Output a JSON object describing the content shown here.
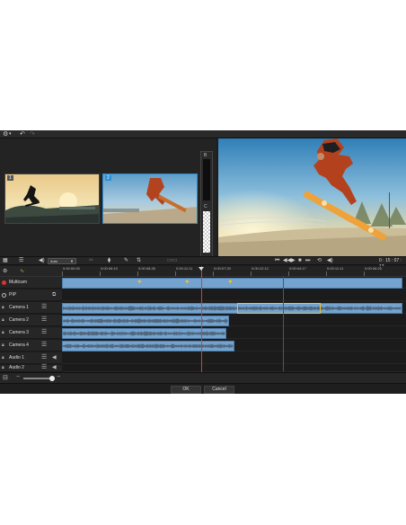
{
  "toolbar": {
    "settings_icon": "gear-icon",
    "undo_icon": "undo-icon",
    "redo_icon": "redo-icon"
  },
  "source_panel": {
    "cameras": [
      {
        "label": "1",
        "selected": false
      },
      {
        "label": "2",
        "selected": true
      }
    ],
    "meter_labels": {
      "top": "B",
      "bottom": "C"
    }
  },
  "transport": {
    "zoom_value": "Auto",
    "timecode": "0 : 15 : 07 : 17"
  },
  "timeline": {
    "ruler_ticks": [
      "0:00:00:00",
      "0:00:06:19",
      "0:00:08:26",
      "0:00:11:11",
      "0:00:07:20",
      "0:00:12:12",
      "0:00:04:17",
      "0:00:11:11",
      "0:00:06:25"
    ],
    "tracks": [
      {
        "name": "Multicam",
        "type": "multicam"
      },
      {
        "name": "PIP",
        "type": "pip"
      },
      {
        "name": "Camera 1",
        "type": "camera"
      },
      {
        "name": "Camera 2",
        "type": "camera"
      },
      {
        "name": "Camera 3",
        "type": "camera"
      },
      {
        "name": "Camera 4",
        "type": "camera"
      },
      {
        "name": "Audio 1",
        "type": "audio"
      },
      {
        "name": "Audio 2",
        "type": "audio"
      }
    ]
  },
  "footer": {
    "ok_label": "OK",
    "cancel_label": "Cancel"
  },
  "colors": {
    "clip": "#73a3ce",
    "playhead": "#e03a3a",
    "selection": "#2d8fd6",
    "marker": "#f2c12e"
  }
}
